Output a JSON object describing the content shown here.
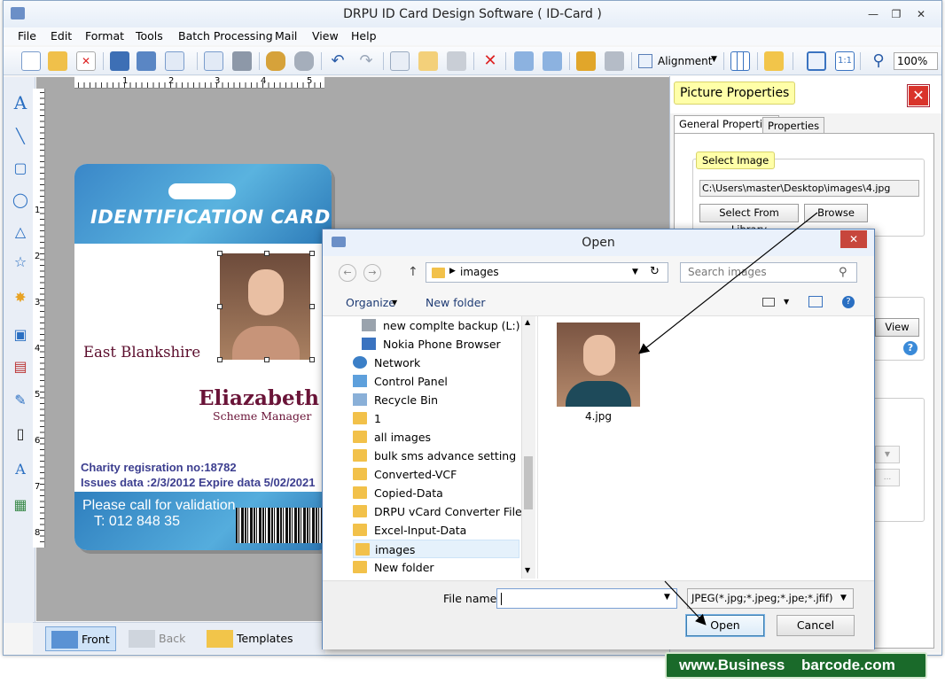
{
  "window": {
    "title": "DRPU ID Card Design Software ( ID-Card )"
  },
  "menu": [
    "File",
    "Edit",
    "Format",
    "Tools",
    "Batch Processing",
    "Mail",
    "View",
    "Help"
  ],
  "toolbar": {
    "alignment_label": "Alignment",
    "zoom_value": "100%"
  },
  "ruler": {
    "h_ticks": [
      "1",
      "2",
      "3",
      "4",
      "5"
    ],
    "v_ticks": [
      "1",
      "2",
      "3",
      "4",
      "5",
      "6",
      "7",
      "8"
    ]
  },
  "card": {
    "title": "IDENTIFICATION CARD",
    "organization": "East Blankshire",
    "name": "Eliazabeth",
    "role": "Scheme Manager",
    "registration": "Charity regisration no:18782",
    "issue": "Issues data :2/3/2012 Expire data 5/02/2021",
    "validation": "Please call for validation",
    "phone": "T: 012 848 35"
  },
  "bottom_tabs": [
    "Front",
    "Back",
    "Templates"
  ],
  "picture_properties": {
    "title": "Picture Properties",
    "tabs": [
      "General Properties",
      "Properties"
    ],
    "select_image_label": "Select Image",
    "path": "C:\\Users\\master\\Desktop\\images\\4.jpg",
    "select_library_label": "Select From Library",
    "browse_label": "Browse",
    "view_label": "View"
  },
  "open_dialog": {
    "title": "Open",
    "address": "images",
    "search_placeholder": "Search images",
    "organize_label": "Organize",
    "new_folder_label": "New folder",
    "nav_items": [
      "new complte backup (L:)",
      "Nokia Phone Browser",
      "Network",
      "Control Panel",
      "Recycle Bin",
      "1",
      "all images",
      "bulk sms advance setting",
      "Converted-VCF",
      "Copied-Data",
      "DRPU vCard Converter Files",
      "Excel-Input-Data",
      "images",
      "New folder"
    ],
    "file_name": "4.jpg",
    "file_name_label": "File name:",
    "file_type": "JPEG(*.jpg;*.jpeg;*.jpe;*.jfif)",
    "open_label": "Open",
    "cancel_label": "Cancel"
  },
  "watermark": {
    "part1": "www.Business",
    "part2": "barcode.com"
  }
}
